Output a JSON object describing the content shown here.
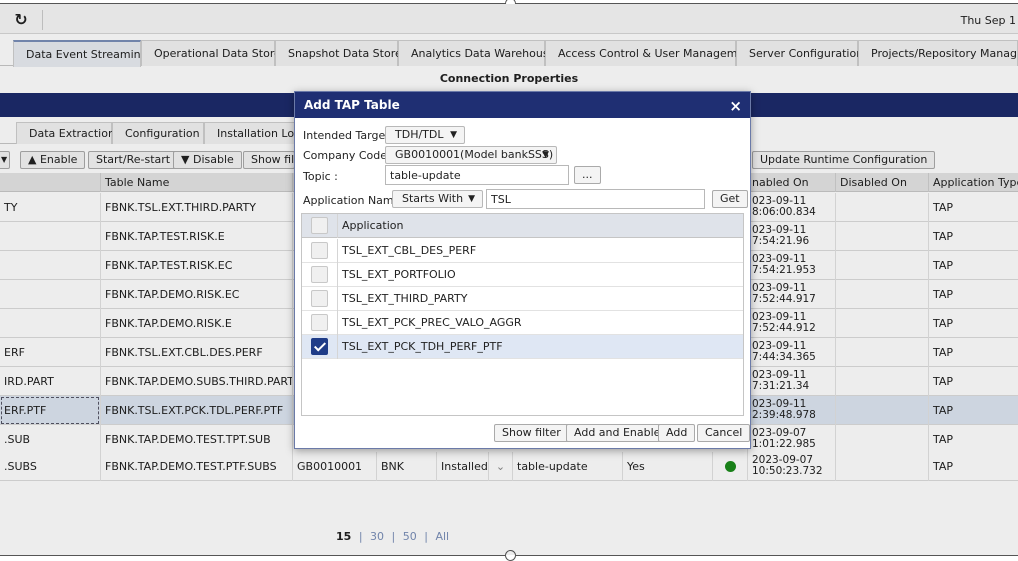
{
  "topbar": {
    "date": "Thu Sep 1"
  },
  "main_tabs": [
    "Data Event Streaming",
    "Operational Data Store",
    "Snapshot Data Store",
    "Analytics Data Warehouse",
    "Access Control & User Management",
    "Server Configuration",
    "Projects/Repository Managemen"
  ],
  "section_title": "Connection Properties",
  "sub_tabs": [
    "Data Extraction",
    "Configuration",
    "Installation Log"
  ],
  "toolbar": {
    "enable": "Enable",
    "start_restart": "Start/Re-start",
    "disable": "Disable",
    "show_filter": "Show filte",
    "update_runtime": "Update Runtime Configuration"
  },
  "table": {
    "headers": {
      "table_name": "Table Name",
      "enabled_on": "nabled On",
      "disabled_on": "Disabled On",
      "application_type": "Application Type"
    },
    "rows": [
      {
        "first": "TY",
        "table_name": "FBNK.TSL.EXT.THIRD.PARTY",
        "date": "023-09-11",
        "time": "8:06:00.834",
        "type": "TAP"
      },
      {
        "first": "",
        "table_name": "FBNK.TAP.TEST.RISK.E",
        "date": "023-09-11",
        "time": "7:54:21.96",
        "type": "TAP"
      },
      {
        "first": "",
        "table_name": "FBNK.TAP.TEST.RISK.EC",
        "date": "023-09-11",
        "time": "7:54:21.953",
        "type": "TAP"
      },
      {
        "first": "",
        "table_name": "FBNK.TAP.DEMO.RISK.EC",
        "date": "023-09-11",
        "time": "7:52:44.917",
        "type": "TAP"
      },
      {
        "first": "",
        "table_name": "FBNK.TAP.DEMO.RISK.E",
        "date": "023-09-11",
        "time": "7:52:44.912",
        "type": "TAP"
      },
      {
        "first": "ERF",
        "table_name": "FBNK.TSL.EXT.CBL.DES.PERF",
        "date": "023-09-11",
        "time": "7:44:34.365",
        "type": "TAP"
      },
      {
        "first": "IRD.PART",
        "table_name": "FBNK.TAP.DEMO.SUBS.THIRD.PART",
        "date": "023-09-11",
        "time": "7:31:21.34",
        "type": "TAP"
      },
      {
        "first": "ERF.PTF",
        "table_name": "FBNK.TSL.EXT.PCK.TDL.PERF.PTF",
        "date": "023-09-11",
        "time": "2:39:48.978",
        "type": "TAP"
      },
      {
        "first": ".SUB",
        "table_name": "FBNK.TAP.DEMO.TEST.TPT.SUB",
        "date": "023-09-07",
        "time": "1:01:22.985",
        "type": "TAP"
      }
    ],
    "last_row": {
      "first": ".SUBS",
      "table_name": "FBNK.TAP.DEMO.TEST.PTF.SUBS",
      "company": "GB0010001",
      "bank": "BNK",
      "status": "Installed",
      "topic": "table-update",
      "enabled": "Yes",
      "date": "2023-09-07",
      "time": "10:50:23.732",
      "type": "TAP"
    }
  },
  "pagination": {
    "current": "15",
    "options": [
      "30",
      "50",
      "All"
    ]
  },
  "modal": {
    "title": "Add TAP Table",
    "close": "×",
    "intended_target_label": "Intended Target :",
    "intended_target_value": "TDH/TDL",
    "company_code_label": "Company Code :",
    "company_code_value": "GB0010001(Model bankSSS)",
    "topic_label": "Topic :",
    "topic_value": "table-update",
    "topic_browse": "...",
    "app_name_label": "Application Name :",
    "app_name_mode": "Starts With",
    "app_name_value": "TSL",
    "get": "Get",
    "list_header": "Application",
    "applications": [
      {
        "name": "TSL_EXT_CBL_DES_PERF",
        "checked": false
      },
      {
        "name": "TSL_EXT_PORTFOLIO",
        "checked": false
      },
      {
        "name": "TSL_EXT_THIRD_PARTY",
        "checked": false
      },
      {
        "name": "TSL_EXT_PCK_PREC_VALO_AGGR",
        "checked": false
      },
      {
        "name": "TSL_EXT_PCK_TDH_PERF_PTF",
        "checked": true
      }
    ],
    "buttons": {
      "show_filter": "Show filter",
      "add_enable": "Add and Enable",
      "add": "Add",
      "cancel": "Cancel"
    }
  },
  "colors": {
    "nav_bar": "#1c2b6b",
    "modal_header": "#1f2f73",
    "checkbox_on": "#1f3c88",
    "status_green": "#1a8a1a"
  }
}
